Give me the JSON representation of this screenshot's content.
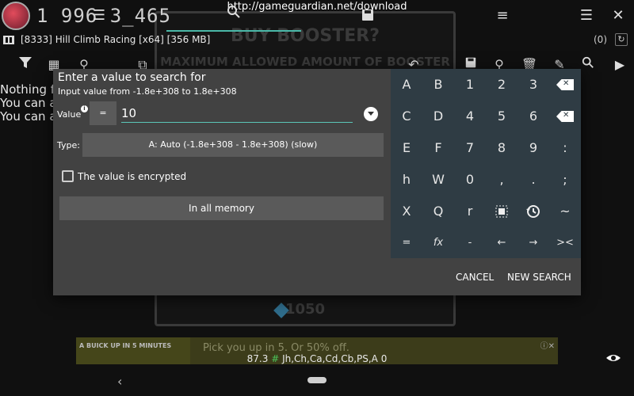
{
  "overlay": {
    "url": "http://gameguardian.net/download",
    "score": "1 996 3_465",
    "process": "[8333] Hill Climb Racing [x64] [356 MB]",
    "result_count": "(0)",
    "bg_lines": [
      "Nothing fo",
      "You can a",
      "You can a"
    ]
  },
  "game": {
    "title": "BUY BOOSTER?",
    "subtitle": "MAXIMUM ALLOWED AMOUNT OF BOOSTER IS",
    "bottom_number": "1050"
  },
  "ad": {
    "left_text": "A BUICK UP IN 5 MINUTES",
    "text": "Pick you up in 5. Or 50% off."
  },
  "status": {
    "number": "87.3",
    "hash": "#",
    "text": "Jh,Ch,Ca,Cd,Cb,PS,A 0"
  },
  "dialog": {
    "title": "Enter a value to search for",
    "range": "Input value from -1.8e+308 to 1.8e+308",
    "value_label": "Value",
    "info": "i",
    "operator": "=",
    "value": "10",
    "type_label": "Type:",
    "type_value": "A: Auto (-1.8e+308 - 1.8e+308) (slow)",
    "encrypted_label": "The value is encrypted",
    "memory_button": "In all memory",
    "cancel": "CANCEL",
    "new_search": "NEW SEARCH"
  },
  "keypad": {
    "rows": [
      [
        "A",
        "B",
        "1",
        "2",
        "3",
        "backspace"
      ],
      [
        "C",
        "D",
        "4",
        "5",
        "6",
        "clear"
      ],
      [
        "E",
        "F",
        "7",
        "8",
        "9",
        ":"
      ],
      [
        "h",
        "W",
        "0",
        ",",
        ".",
        ";"
      ],
      [
        "X",
        "Q",
        "r",
        "select-all",
        "history",
        "~"
      ],
      [
        "=",
        "fx",
        "-",
        "←",
        "→",
        "><"
      ]
    ]
  },
  "colors": {
    "dialog_bg": "#424242",
    "keypad_bg": "#2f3c44",
    "accent": "#5bc6b8",
    "button_bg": "#5a5a5a"
  }
}
